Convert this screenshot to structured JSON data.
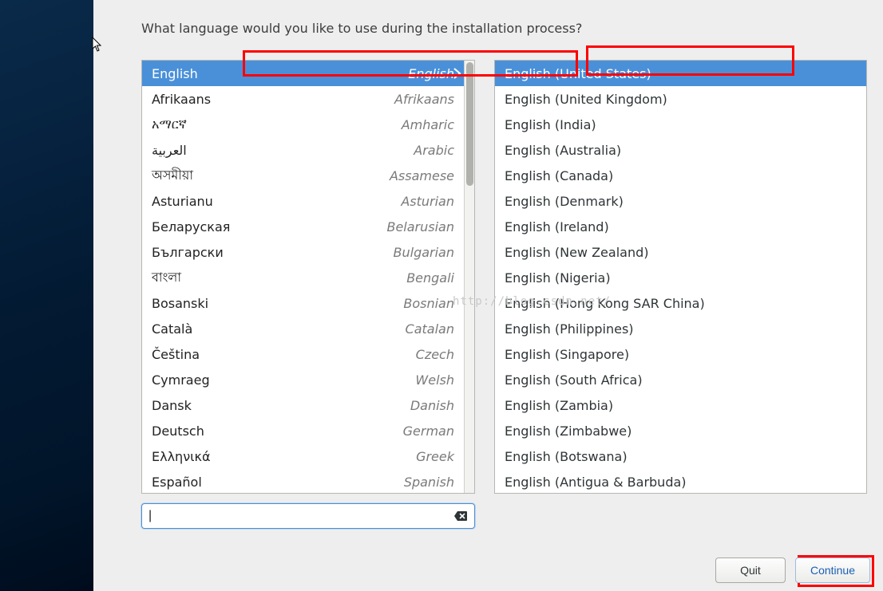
{
  "prompt": "What language would you like to use during the installation process?",
  "languages": [
    {
      "native": "English",
      "english": "English",
      "selected": true
    },
    {
      "native": "Afrikaans",
      "english": "Afrikaans",
      "selected": false
    },
    {
      "native": "አማርኛ",
      "english": "Amharic",
      "selected": false
    },
    {
      "native": "العربية",
      "english": "Arabic",
      "selected": false
    },
    {
      "native": "অসমীয়া",
      "english": "Assamese",
      "selected": false
    },
    {
      "native": "Asturianu",
      "english": "Asturian",
      "selected": false
    },
    {
      "native": "Беларуская",
      "english": "Belarusian",
      "selected": false
    },
    {
      "native": "Български",
      "english": "Bulgarian",
      "selected": false
    },
    {
      "native": "বাংলা",
      "english": "Bengali",
      "selected": false
    },
    {
      "native": "Bosanski",
      "english": "Bosnian",
      "selected": false
    },
    {
      "native": "Català",
      "english": "Catalan",
      "selected": false
    },
    {
      "native": "Čeština",
      "english": "Czech",
      "selected": false
    },
    {
      "native": "Cymraeg",
      "english": "Welsh",
      "selected": false
    },
    {
      "native": "Dansk",
      "english": "Danish",
      "selected": false
    },
    {
      "native": "Deutsch",
      "english": "German",
      "selected": false
    },
    {
      "native": "Ελληνικά",
      "english": "Greek",
      "selected": false
    },
    {
      "native": "Español",
      "english": "Spanish",
      "selected": false
    }
  ],
  "locales": [
    {
      "label": "English (United States)",
      "selected": true
    },
    {
      "label": "English (United Kingdom)",
      "selected": false
    },
    {
      "label": "English (India)",
      "selected": false
    },
    {
      "label": "English (Australia)",
      "selected": false
    },
    {
      "label": "English (Canada)",
      "selected": false
    },
    {
      "label": "English (Denmark)",
      "selected": false
    },
    {
      "label": "English (Ireland)",
      "selected": false
    },
    {
      "label": "English (New Zealand)",
      "selected": false
    },
    {
      "label": "English (Nigeria)",
      "selected": false
    },
    {
      "label": "English (Hong Kong SAR China)",
      "selected": false
    },
    {
      "label": "English (Philippines)",
      "selected": false
    },
    {
      "label": "English (Singapore)",
      "selected": false
    },
    {
      "label": "English (South Africa)",
      "selected": false
    },
    {
      "label": "English (Zambia)",
      "selected": false
    },
    {
      "label": "English (Zimbabwe)",
      "selected": false
    },
    {
      "label": "English (Botswana)",
      "selected": false
    },
    {
      "label": "English (Antigua & Barbuda)",
      "selected": false
    }
  ],
  "search": {
    "value": "",
    "placeholder": "|"
  },
  "buttons": {
    "quit": "Quit",
    "continue": "Continue"
  },
  "watermark": "http://blog.csdn.net/"
}
